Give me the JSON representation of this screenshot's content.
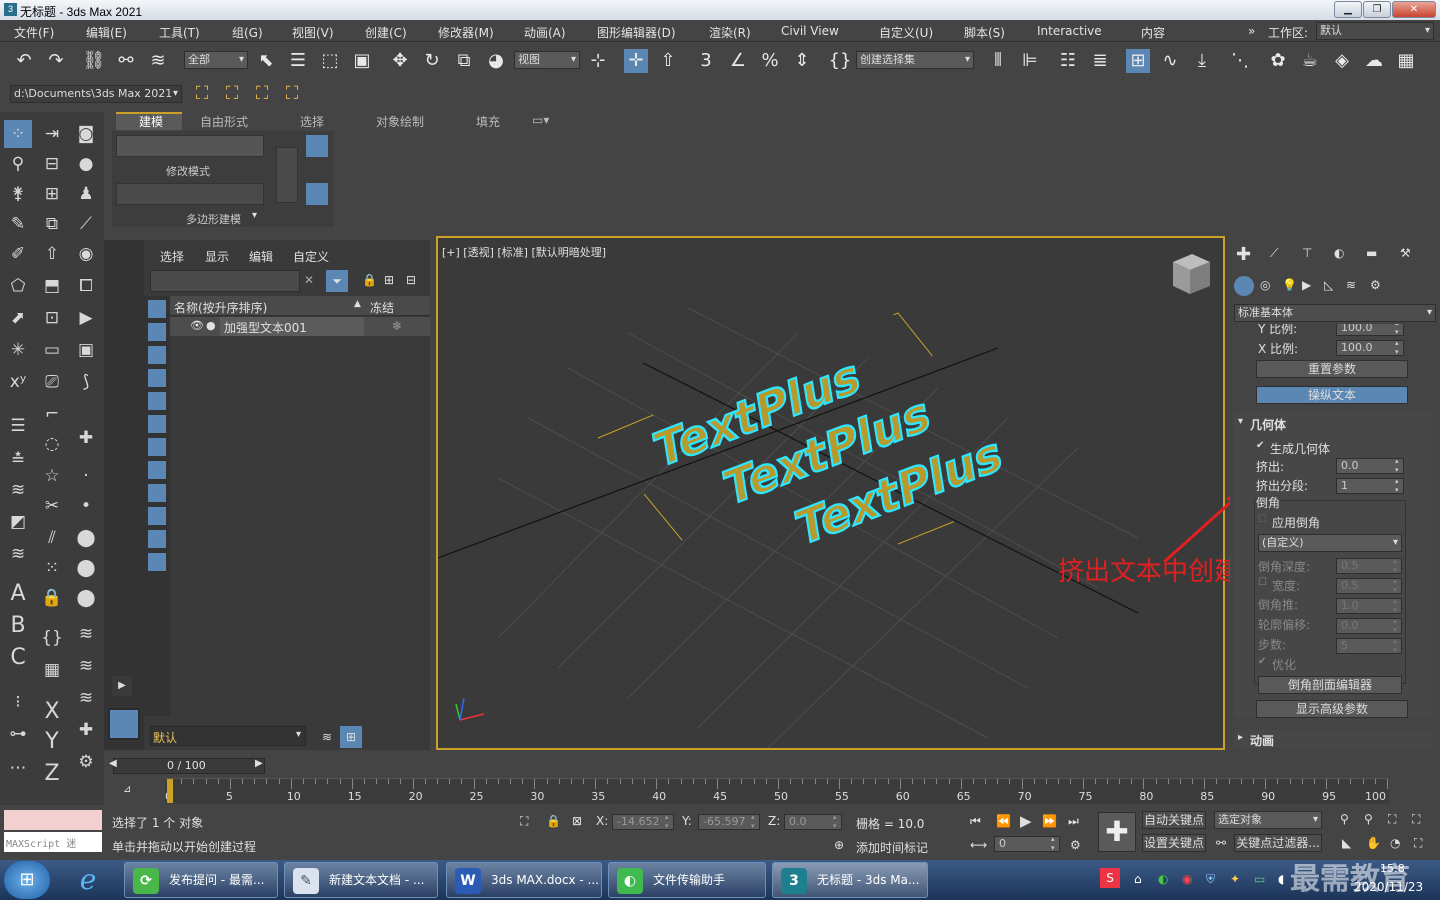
{
  "window": {
    "title": "无标题 - 3ds Max 2021",
    "logo": "3"
  },
  "menu": [
    "文件(F)",
    "编辑(E)",
    "工具(T)",
    "组(G)",
    "视图(V)",
    "创建(C)",
    "修改器(M)",
    "动画(A)",
    "图形编辑器(D)",
    "渲染(R)",
    "Civil View",
    "自定义(U)",
    "脚本(S)",
    "Interactive",
    "内容"
  ],
  "workspace": {
    "label": "工作区:",
    "value": "默认",
    "chevron": "»"
  },
  "toolbar": {
    "filter": "全部",
    "coord": "视图",
    "selset": "创建选择集",
    "path": "d:\\Documents\\3ds Max 2021"
  },
  "ribbon": {
    "tabs": [
      "建模",
      "自由形式",
      "选择",
      "对象绘制",
      "填充"
    ],
    "group1": "修改模式",
    "group2": "多边形建模"
  },
  "explorer": {
    "tabs": [
      "选择",
      "显示",
      "编辑",
      "自定义"
    ],
    "col_name": "名称(按升序排序)",
    "col_freeze": "冻结",
    "sort_arrow": "▲",
    "item": "加强型文本001",
    "layer": "默认"
  },
  "viewport": {
    "label": "[+] [透视] [标准] [默认明暗处理]",
    "texts": [
      "TextPlus",
      "TextPlus",
      "TextPlus"
    ]
  },
  "panel": {
    "dropdown": "标准基本体",
    "rows": [
      {
        "label": "Y 比例:",
        "value": "100.0"
      },
      {
        "label": "X 比例:",
        "value": "100.0"
      }
    ],
    "reset": "重置参数",
    "manip": "操纵文本",
    "geometry": "几何体",
    "gen_geom": "生成几何体",
    "extrude_label": "挤出:",
    "extrude_val": "0.0",
    "segs_label": "挤出分段:",
    "segs_val": "1",
    "bevel": "倒角",
    "apply_bevel": "应用倒角",
    "custom": "(自定义)",
    "bevel_depth": "倒角深度:",
    "bevel_depth_val": "0.5",
    "width_label": "宽度:",
    "width_val": "0.5",
    "bevel_push": "倒角推:",
    "bevel_push_val": "1.0",
    "outline": "轮廓偏移:",
    "outline_val": "0.0",
    "steps": "步数:",
    "steps_val": "5",
    "optimize": "优化",
    "profile_editor": "倒角剖面编辑器",
    "advanced": "显示高级参数",
    "anim": "动画"
  },
  "annotation": "挤出文本中创建的分段数",
  "timeline": {
    "pos": "0 / 100",
    "ticks": [
      "0",
      "5",
      "10",
      "15",
      "20",
      "25",
      "30",
      "35",
      "40",
      "45",
      "50",
      "55",
      "60",
      "65",
      "70",
      "75",
      "80",
      "85",
      "90",
      "95",
      "100"
    ]
  },
  "status": {
    "selected": "选择了 1 个 对象",
    "hint": "单击并拖动以开始创建过程",
    "maxscript": "MAXScript 迷",
    "x": "-14.652",
    "y": "-65.597",
    "z": "0.0",
    "grid": "栅格 = 10.0",
    "addtime": "添加时间标记",
    "autokey": "自动关键点",
    "setkey": "设置关键点",
    "selobj": "选定对象",
    "keyfilter": "关键点过滤器...",
    "frame": "0"
  },
  "taskbar": {
    "items": [
      "发布提问 - 最需...",
      "新建文本文档 - ...",
      "3ds MAX.docx - ...",
      "文件传输助手",
      "无标题 - 3ds Ma..."
    ],
    "time": "2020/11/23",
    "clock": "15:8",
    "watermark": "最需教育"
  }
}
